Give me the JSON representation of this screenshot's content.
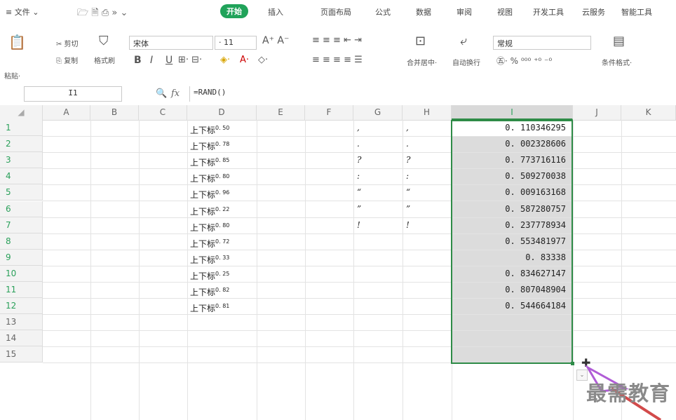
{
  "menu": {
    "items": [
      "≡ 文件 ⌄",
      "开始",
      "插入",
      "页面布局",
      "公式",
      "数据",
      "审阅",
      "视图",
      "开发工具",
      "云服务",
      "智能工具"
    ]
  },
  "ribbon": {
    "paste_label": "粘贴·",
    "cut_label": "✂ 剪切",
    "copy_label": "复制",
    "format_painter_label": "格式刷",
    "font_name": "宋体",
    "font_size": "11",
    "merge_label": "合并居中·",
    "wrap_label": "自动换行",
    "number_format": "常规",
    "conditional_label": "条件格式·"
  },
  "formula_bar": {
    "cell_ref": "I1",
    "fx_label": "fx",
    "formula": "=RAND()"
  },
  "columns": [
    "A",
    "B",
    "C",
    "D",
    "E",
    "F",
    "G",
    "H",
    "I",
    "J",
    "K"
  ],
  "rows": [
    {
      "n": "1",
      "d_base": "上下标",
      "d_sup": "0. 50",
      "g": ",",
      "h": ",",
      "i": "0. 110346295"
    },
    {
      "n": "2",
      "d_base": "上下标",
      "d_sup": "0. 78",
      "g": ".",
      "h": ".",
      "i": "0. 002328606"
    },
    {
      "n": "3",
      "d_base": "上下标",
      "d_sup": "0. 85",
      "g": "?",
      "h": "?",
      "i": "0. 773716116"
    },
    {
      "n": "4",
      "d_base": "上下标",
      "d_sup": "0. 80",
      "g": ":",
      "h": ":",
      "i": "0. 509270038"
    },
    {
      "n": "5",
      "d_base": "上下标",
      "d_sup": "0. 96",
      "g": "“",
      "h": "“",
      "i": "0. 009163168"
    },
    {
      "n": "6",
      "d_base": "上下标",
      "d_sup": "0. 22",
      "g": "”",
      "h": "”",
      "i": "0. 587280757"
    },
    {
      "n": "7",
      "d_base": "上下标",
      "d_sup": "0. 80",
      "g": "!",
      "h": "!",
      "i": "0. 237778934"
    },
    {
      "n": "8",
      "d_base": "上下标",
      "d_sup": "0. 72",
      "g": "",
      "h": "",
      "i": "0. 553481977"
    },
    {
      "n": "9",
      "d_base": "上下标",
      "d_sup": "0. 33",
      "g": "",
      "h": "",
      "i": "0. 83338"
    },
    {
      "n": "10",
      "d_base": "上下标",
      "d_sup": "0. 25",
      "g": "",
      "h": "",
      "i": "0. 834627147"
    },
    {
      "n": "11",
      "d_base": "上下标",
      "d_sup": "0. 82",
      "g": "",
      "h": "",
      "i": "0. 807048904"
    },
    {
      "n": "12",
      "d_base": "上下标",
      "d_sup": "0. 81",
      "g": "",
      "h": "",
      "i": "0. 544664184"
    },
    {
      "n": "13",
      "d_base": "",
      "d_sup": "",
      "g": "",
      "h": "",
      "i": ""
    },
    {
      "n": "14",
      "d_base": "",
      "d_sup": "",
      "g": "",
      "h": "",
      "i": ""
    },
    {
      "n": "15",
      "d_base": "",
      "d_sup": "",
      "g": "",
      "h": "",
      "i": ""
    }
  ],
  "watermark": "最需教育",
  "colors": {
    "accent": "#20a35a",
    "selection_border": "#2e8b47",
    "selection_fill": "#dcdcdc"
  }
}
